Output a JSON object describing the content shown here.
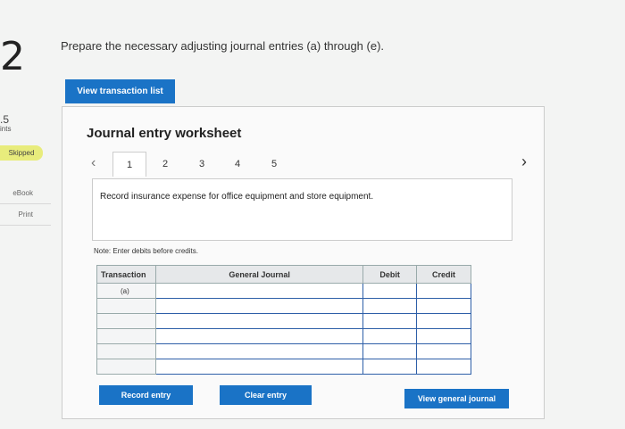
{
  "question": {
    "number": "2",
    "prompt": "Prepare the necessary adjusting journal entries (a) through (e)."
  },
  "side": {
    "points_value": ".5",
    "points_label": "ints",
    "status_badge": "Skipped",
    "ebook_label": "eBook",
    "print_label": "Print"
  },
  "buttons": {
    "view_transaction_list": "View transaction list",
    "record_entry": "Record entry",
    "clear_entry": "Clear entry",
    "view_general_journal": "View general journal"
  },
  "worksheet": {
    "title": "Journal entry worksheet",
    "tabs": [
      "1",
      "2",
      "3",
      "4",
      "5"
    ],
    "active_tab": "1",
    "description": "Record insurance expense for office equipment and store equipment.",
    "note": "Note: Enter debits before credits."
  },
  "table": {
    "headers": {
      "transaction": "Transaction",
      "general_journal": "General Journal",
      "debit": "Debit",
      "credit": "Credit"
    },
    "transaction_label": "(a)"
  }
}
